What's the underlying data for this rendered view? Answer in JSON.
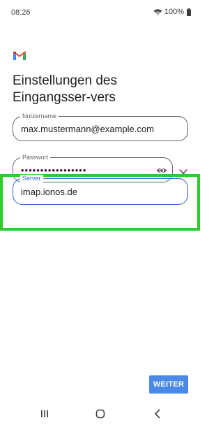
{
  "status_bar": {
    "time": "08:26",
    "battery": "100%"
  },
  "page": {
    "title": "Einstellungen des Eingangsser-vers"
  },
  "form": {
    "username": {
      "label": "Nutzername",
      "value": "max.mustermann@example.com"
    },
    "password": {
      "label": "Passwort",
      "value": "•••••••••••••••••"
    },
    "server": {
      "label": "Server",
      "value": "imap.ionos.de"
    }
  },
  "actions": {
    "next_label": "WEITER"
  },
  "colors": {
    "accent": "#2f5ed8",
    "button": "#4a89e8",
    "highlight": "#2ecc2e"
  }
}
